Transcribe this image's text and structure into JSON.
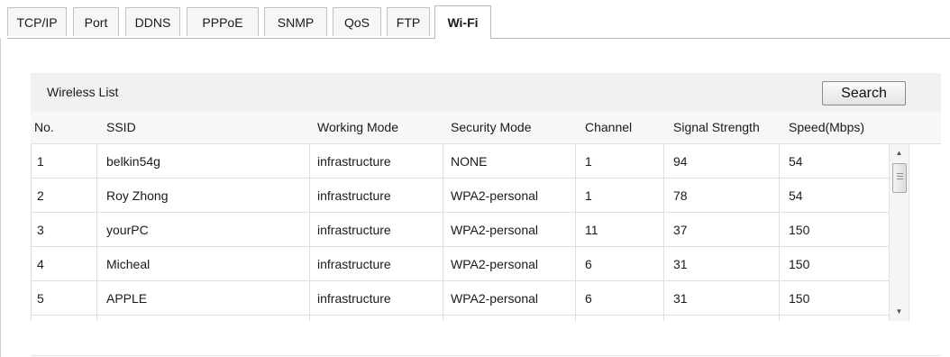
{
  "tabs": [
    {
      "label": "TCP/IP",
      "active": false
    },
    {
      "label": "Port",
      "active": false
    },
    {
      "label": "DDNS",
      "active": false
    },
    {
      "label": "PPPoE",
      "active": false
    },
    {
      "label": "SNMP",
      "active": false
    },
    {
      "label": "QoS",
      "active": false
    },
    {
      "label": "FTP",
      "active": false
    },
    {
      "label": "Wi-Fi",
      "active": true
    }
  ],
  "wireless_list": {
    "title": "Wireless List",
    "search_label": "Search",
    "columns": [
      "No.",
      "SSID",
      "Working Mode",
      "Security Mode",
      "Channel",
      "Signal Strength",
      "Speed(Mbps)"
    ],
    "rows": [
      [
        "1",
        "belkin54g",
        "infrastructure",
        "NONE",
        "1",
        "94",
        "54"
      ],
      [
        "2",
        "Roy Zhong",
        "infrastructure",
        "WPA2-personal",
        "1",
        "78",
        "54"
      ],
      [
        "3",
        "yourPC",
        "infrastructure",
        "WPA2-personal",
        "11",
        "37",
        "150"
      ],
      [
        "4",
        "Micheal",
        "infrastructure",
        "WPA2-personal",
        "6",
        "31",
        "150"
      ],
      [
        "5",
        "APPLE",
        "infrastructure",
        "WPA2-personal",
        "6",
        "31",
        "150"
      ]
    ]
  },
  "icons": {
    "scroll_up": "scroll-up-arrow-icon",
    "scroll_down": "scroll-down-arrow-icon",
    "scroll_thumb": "scroll-thumb-grip-icon"
  },
  "colors": {
    "header_bg": "#f1f1f1",
    "column_header_bg": "#f7f7f7",
    "grid_line": "#dedede",
    "tab_border": "#c2c2c2"
  }
}
